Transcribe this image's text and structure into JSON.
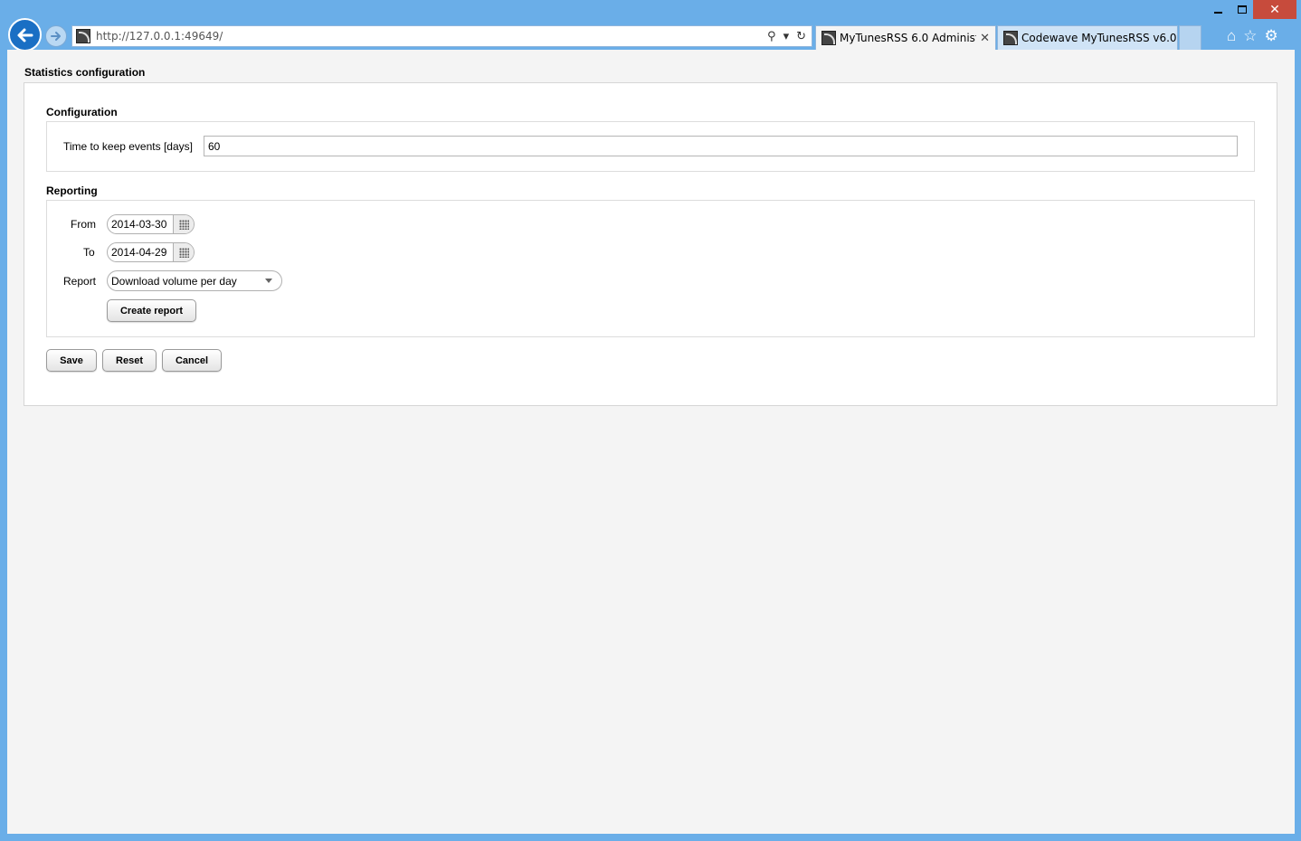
{
  "browser": {
    "url": "http://127.0.0.1:49649/",
    "tabs": [
      {
        "label": "MyTunesRSS 6.0 Administra...",
        "active": true
      },
      {
        "label": "Codewave MyTunesRSS v6.0",
        "active": false
      }
    ]
  },
  "page": {
    "title": "Statistics configuration",
    "configuration": {
      "heading": "Configuration",
      "keep_events_label": "Time to keep events [days]",
      "keep_events_value": "60"
    },
    "reporting": {
      "heading": "Reporting",
      "from_label": "From",
      "from_value": "2014-03-30",
      "to_label": "To",
      "to_value": "2014-04-29",
      "report_label": "Report",
      "report_value": "Download volume per day",
      "create_report_label": "Create report"
    },
    "buttons": {
      "save": "Save",
      "reset": "Reset",
      "cancel": "Cancel"
    }
  },
  "colors": {
    "frame": "#6aaee8",
    "back_button": "#1a6fc4",
    "close_button": "#c74b3c"
  }
}
